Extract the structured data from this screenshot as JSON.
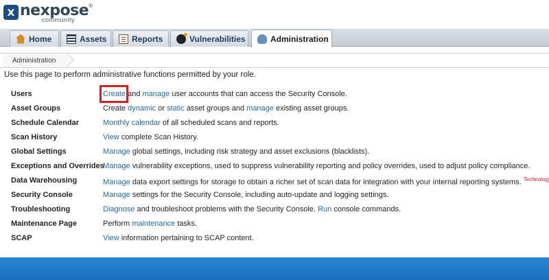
{
  "app": {
    "logo_name": "nexpose",
    "logo_reg": "®",
    "logo_sub": "community",
    "logo_mark": "x"
  },
  "nav": {
    "tabs": [
      {
        "label": "Home",
        "icon": "home-icon",
        "active": false
      },
      {
        "label": "Assets",
        "icon": "assets-icon",
        "active": false
      },
      {
        "label": "Reports",
        "icon": "reports-icon",
        "active": false
      },
      {
        "label": "Vulnerabilities",
        "icon": "vulnerabilities-icon",
        "active": false
      },
      {
        "label": "Administration",
        "icon": "administration-icon",
        "active": true
      }
    ]
  },
  "breadcrumb": {
    "current": "Administration"
  },
  "intro": "Use this page to perform administrative functions permitted by your role.",
  "rows": [
    {
      "label": "Users",
      "segments": [
        {
          "text": "Create",
          "link": true
        },
        {
          "text": " and ",
          "link": false
        },
        {
          "text": "manage",
          "link": true
        },
        {
          "text": " user accounts that can access the Security Console.",
          "link": false
        }
      ]
    },
    {
      "label": "Asset Groups",
      "segments": [
        {
          "text": "Create ",
          "link": false
        },
        {
          "text": "dynamic",
          "link": true
        },
        {
          "text": " or ",
          "link": false
        },
        {
          "text": "static",
          "link": true
        },
        {
          "text": " asset groups and ",
          "link": false
        },
        {
          "text": "manage",
          "link": true
        },
        {
          "text": " existing asset groups.",
          "link": false
        }
      ]
    },
    {
      "label": "Schedule Calendar",
      "segments": [
        {
          "text": "Monthly calendar",
          "link": true
        },
        {
          "text": " of all scheduled scans and reports.",
          "link": false
        }
      ]
    },
    {
      "label": "Scan History",
      "segments": [
        {
          "text": "View",
          "link": true
        },
        {
          "text": " complete Scan History.",
          "link": false
        }
      ]
    },
    {
      "label": "Global Settings",
      "segments": [
        {
          "text": "Manage",
          "link": true
        },
        {
          "text": " global settings, including risk strategy and asset exclusions (blacklists).",
          "link": false
        }
      ]
    },
    {
      "label": "Exceptions and Overrides",
      "segments": [
        {
          "text": "Manage",
          "link": true
        },
        {
          "text": " vulnerability exceptions, used to suppress vulnerability reporting and policy overrides, used to adjust policy compliance.",
          "link": false
        }
      ]
    },
    {
      "label": "Data Warehousing",
      "segments": [
        {
          "text": "Manage",
          "link": true
        },
        {
          "text": " data export settings for storage to obtain a richer set of scan data for integration with your internal reporting systems.",
          "link": false
        }
      ],
      "badge": "Technology Preview"
    },
    {
      "label": "Security Console",
      "segments": [
        {
          "text": "Manage",
          "link": true
        },
        {
          "text": " settings for the Security Console, including auto-update and logging settings.",
          "link": false
        }
      ]
    },
    {
      "label": "Troubleshooting",
      "segments": [
        {
          "text": "Diagnose",
          "link": true
        },
        {
          "text": " and troubleshoot problems with the Security Console. ",
          "link": false
        },
        {
          "text": "Run",
          "link": true
        },
        {
          "text": " console commands.",
          "link": false
        }
      ]
    },
    {
      "label": "Maintenance Page",
      "segments": [
        {
          "text": "Perform ",
          "link": false
        },
        {
          "text": "maintenance",
          "link": true
        },
        {
          "text": " tasks.",
          "link": false
        }
      ]
    },
    {
      "label": "SCAP",
      "segments": [
        {
          "text": "View",
          "link": true
        },
        {
          "text": " information pertaining to SCAP content.",
          "link": false
        }
      ]
    }
  ],
  "colors": {
    "link": "#1f6ba8",
    "highlight": "#d0202a",
    "footer": "#1a6fbf",
    "badge": "#cc2222"
  }
}
